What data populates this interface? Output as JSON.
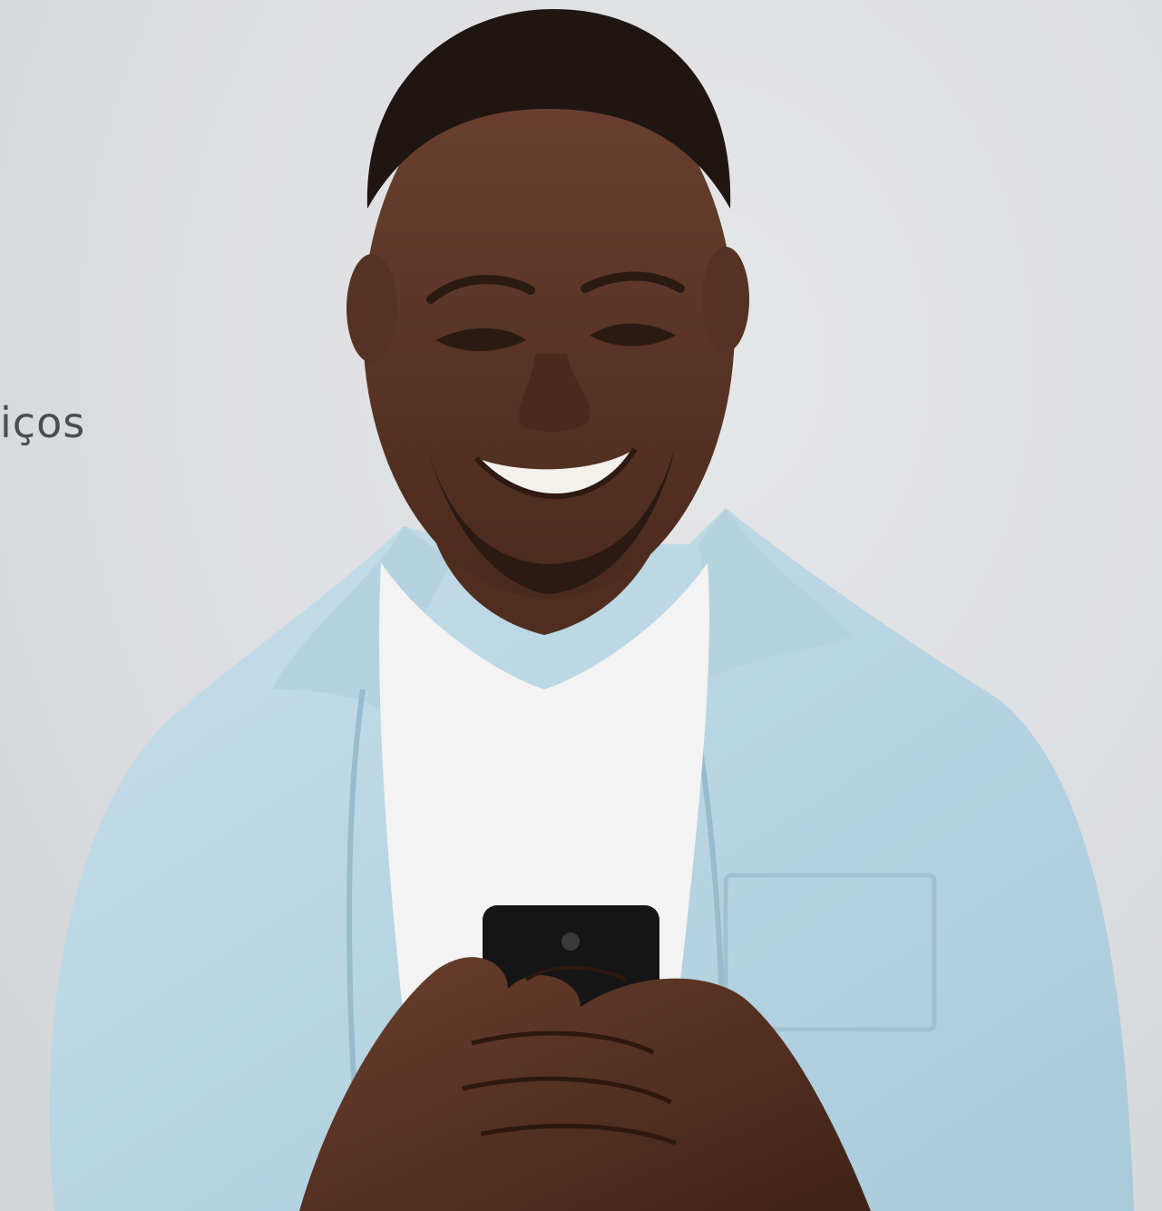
{
  "caption": {
    "text": "iços"
  },
  "colors": {
    "background": "#dedfe1",
    "shirt": "#b9d6e3",
    "undershirt": "#f1f1f1",
    "skin": "#5a3626",
    "text": "#4a4d52"
  }
}
